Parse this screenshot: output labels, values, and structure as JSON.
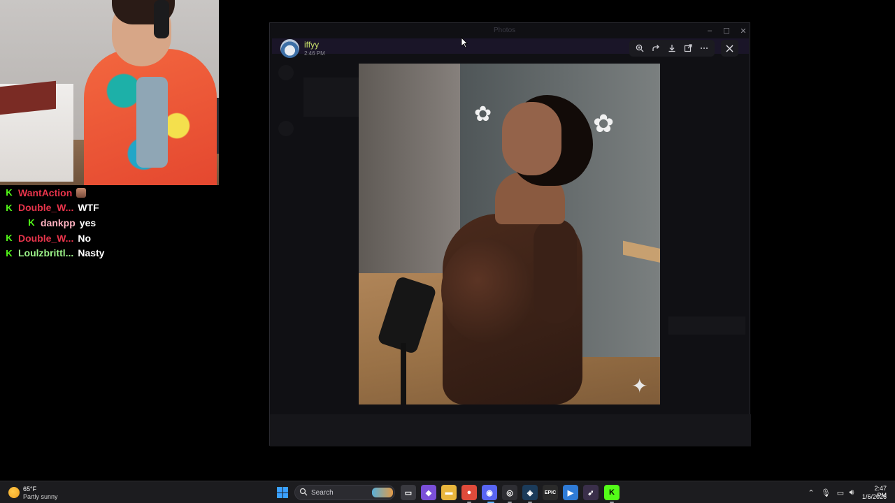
{
  "chat": {
    "messages": [
      {
        "user": "WantAction",
        "user_color": "#e8344b",
        "text": "",
        "emote": "face-emote",
        "badge": "K"
      },
      {
        "user": "Double_W...",
        "user_color": "#e8344b",
        "text": "WTF",
        "badge": "K"
      },
      {
        "user": "dankpp",
        "user_color": "#ffb3c1",
        "text": "yes",
        "badge": "K"
      },
      {
        "user": "Double_W...",
        "user_color": "#e8344b",
        "text": "No",
        "badge": "K"
      },
      {
        "user": "Loulzbrittl...",
        "user_color": "#9df58a",
        "text": "Nasty",
        "badge": "K"
      }
    ]
  },
  "viewer": {
    "author": "iffyy",
    "time": "2:46 PM",
    "tools": [
      "zoom-in-icon",
      "forward-icon",
      "download-icon",
      "open-external-icon",
      "more-icon"
    ],
    "close_icon": "close-icon"
  },
  "background_window": {
    "title": "Photos"
  },
  "taskbar": {
    "weather_temp": "65°F",
    "weather_desc": "Partly sunny",
    "search_label": "Search",
    "clock_time": "2:47 PM",
    "clock_date": "1/6/2026",
    "apps": [
      {
        "name": "task-view",
        "color": "#3a3a40",
        "glyph": "▭"
      },
      {
        "name": "copilot",
        "color": "#7a4fd8",
        "glyph": "◆"
      },
      {
        "name": "file-explorer",
        "color": "#e9b63d",
        "glyph": "▬"
      },
      {
        "name": "chrome",
        "color": "#e04b3b",
        "glyph": "●"
      },
      {
        "name": "discord",
        "color": "#5865f2",
        "glyph": "◉"
      },
      {
        "name": "obs",
        "color": "#2e2e33",
        "glyph": "◎"
      },
      {
        "name": "steam",
        "color": "#1b3b5a",
        "glyph": "◈"
      },
      {
        "name": "epic-games",
        "color": "#2a2a2a",
        "glyph": "EPIC"
      },
      {
        "name": "visual-studio",
        "color": "#2f7bd6",
        "glyph": "▶"
      },
      {
        "name": "app-arrow",
        "color": "#3a2f4a",
        "glyph": "➶"
      },
      {
        "name": "kick",
        "color": "#53fc18",
        "glyph": "K"
      }
    ]
  }
}
